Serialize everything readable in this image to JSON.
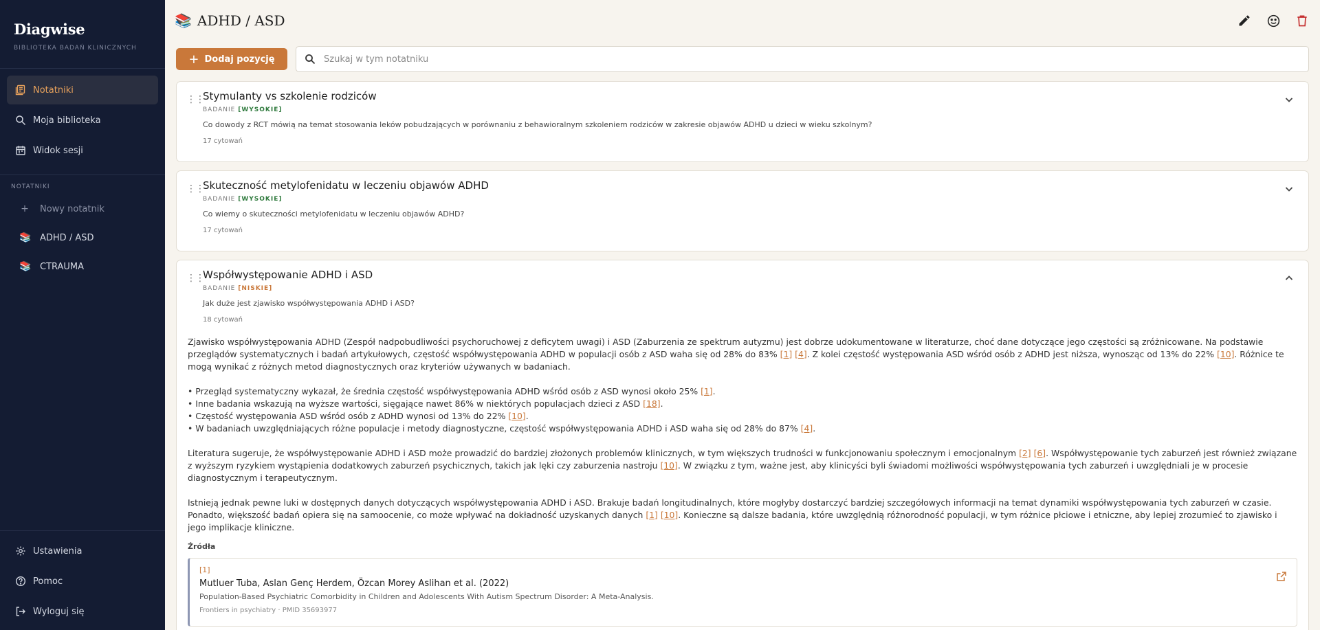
{
  "app": {
    "name": "Diagwise",
    "subtitle": "BIBLIOTEKA BADAŃ KLINICZNYCH"
  },
  "nav": [
    {
      "label": "Notatniki",
      "icon": "notebooks-icon",
      "active": true
    },
    {
      "label": "Moja biblioteka",
      "icon": "search-icon"
    },
    {
      "label": "Widok sesji",
      "icon": "calendar-icon"
    }
  ],
  "notebooks_section": {
    "label": "NOTATNIKI",
    "new_label": "Nowy notatnik",
    "items": [
      {
        "label": "ADHD / ASD",
        "icon": "books-icon"
      },
      {
        "label": "CTRAUMA",
        "icon": "books-icon"
      }
    ]
  },
  "bottom_nav": [
    {
      "label": "Ustawienia",
      "icon": "gear-icon"
    },
    {
      "label": "Pomoc",
      "icon": "help-icon"
    },
    {
      "label": "Wyloguj się",
      "icon": "logout-icon"
    }
  ],
  "header": {
    "title": "ADHD / ASD"
  },
  "toolbar": {
    "add_label": "Dodaj pozycję",
    "search_placeholder": "Szukaj w tym notatniku"
  },
  "cards": [
    {
      "title": "Stymulanty vs szkolenie rodziców",
      "type": "BADANIE",
      "level": "[WYSOKIE]",
      "question": "Co dowody z RCT mówią na temat stosowania leków pobudzających w porównaniu z behawioralnym szkoleniem rodziców w zakresie objawów ADHD u dzieci w wieku szkolnym?",
      "citations": "17 cytowań"
    },
    {
      "title": "Skuteczność metylofenidatu w leczeniu objawów ADHD",
      "type": "BADANIE",
      "level": "[WYSOKIE]",
      "question": "Co wiemy o skuteczności metylofenidatu w leczeniu objawów ADHD?",
      "citations": "17 cytowań"
    },
    {
      "title": "Współwystępowanie ADHD i ASD",
      "type": "BADANIE",
      "level": "[NISKIE]",
      "question": "Jak duże jest zjawisko współwystępowania ADHD i ASD?",
      "citations": "18 cytowań",
      "answer": {
        "p1_a": "Zjawisko współwystępowania ADHD (Zespół nadpobudliwości psychoruchowej z deficytem uwagi) i ASD (Zaburzenia ze spektrum autyzmu) jest dobrze udokumentowane w literaturze, choć dane dotyczące jego częstości są zróżnicowane. Na podstawie przeglądów systematycznych i badań artykułowych, częstość współwystępowania ADHD w populacji osób z ASD waha się od 28% do 83% ",
        "p1_c1": "[1]",
        "p1_c2": "[4]",
        "p1_b": ". Z kolei częstość występowania ASD wśród osób z ADHD jest niższa, wynosząc od 13% do 22% ",
        "p1_c3": "[10]",
        "p1_c": ". Różnice te mogą wynikać z różnych metod diagnostycznych oraz kryteriów używanych w badaniach.",
        "b1": "• Przegląd systematyczny wykazał, że średnia częstość współwystępowania ADHD wśród osób z ASD wynosi około 25% ",
        "b1_c": "[1]",
        "b2": "• Inne badania wskazują na wyższe wartości, sięgające nawet 86% w niektórych populacjach dzieci z ASD ",
        "b2_c": "[18]",
        "b3": "• Częstość występowania ASD wśród osób z ADHD wynosi od 13% do 22% ",
        "b3_c": "[10]",
        "b4": "• W badaniach uwzględniających różne populacje i metody diagnostyczne, częstość współwystępowania ADHD i ASD waha się od 28% do 87% ",
        "b4_c": "[4]",
        "p2_a": "Literatura sugeruje, że współwystępowanie ADHD i ASD może prowadzić do bardziej złożonych problemów klinicznych, w tym większych trudności w funkcjonowaniu społecznym i emocjonalnym ",
        "p2_c1": "[2]",
        "p2_c2": "[6]",
        "p2_b": ". Współwystępowanie tych zaburzeń jest również związane z wyższym ryzykiem wystąpienia dodatkowych zaburzeń psychicznych, takich jak lęki czy zaburzenia nastroju ",
        "p2_c3": "[10]",
        "p2_c": ". W związku z tym, ważne jest, aby klinicyści byli świadomi możliwości współwystępowania tych zaburzeń i uwzględniali je w procesie diagnostycznym i terapeutycznym.",
        "p3_a": "Istnieją jednak pewne luki w dostępnych danych dotyczących współwystępowania ADHD i ASD. Brakuje badań longitudinalnych, które mogłyby dostarczyć bardziej szczegółowych informacji na temat dynamiki współwystępowania tych zaburzeń w czasie. Ponadto, większość badań opiera się na samoocenie, co może wpływać na dokładność uzyskanych danych ",
        "p3_c1": "[1]",
        "p3_c2": "[10]",
        "p3_b": ". Konieczne są dalsze badania, które uwzględnią różnorodność populacji, w tym różnice płciowe i etniczne, aby lepiej zrozumieć to zjawisko i jego implikacje kliniczne."
      },
      "sources_label": "Źródła",
      "sources": [
        {
          "num": "[1]",
          "authors": "Mutluer Tuba, Aslan Genç Herdem, Özcan Morey Aslihan et al. (2022)",
          "title": "Population-Based Psychiatric Comorbidity in Children and Adolescents With Autism Spectrum Disorder: A Meta-Analysis.",
          "journal": "Frontiers in psychiatry · PMID 35693977"
        }
      ]
    }
  ]
}
